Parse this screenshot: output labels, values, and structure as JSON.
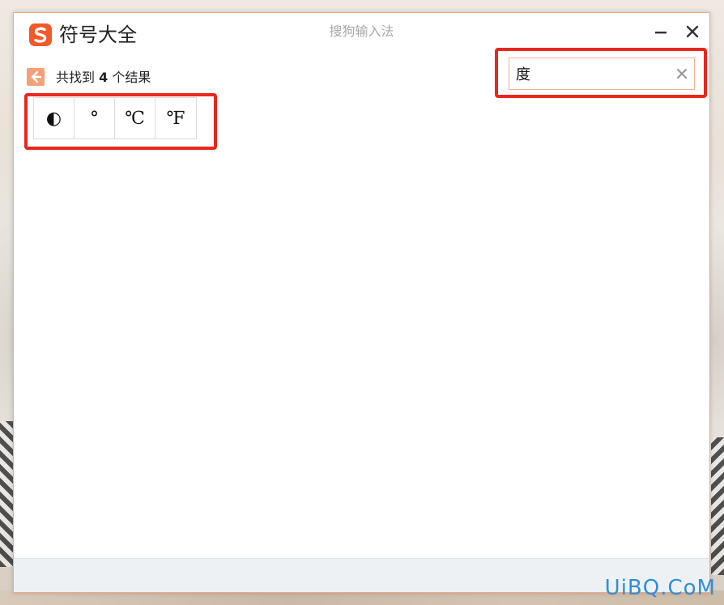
{
  "window": {
    "app_title": "符号大全",
    "center_title": "搜狗输入法"
  },
  "results": {
    "prefix": "共找到 ",
    "count": "4",
    "suffix": " 个结果"
  },
  "search": {
    "value": "度"
  },
  "symbols": [
    "◐",
    "°",
    "℃",
    "℉"
  ],
  "icons": {
    "logo": "sogou-s-logo-icon",
    "minimize": "minimize-icon",
    "close": "close-icon",
    "back": "back-arrow-icon",
    "clear": "clear-x-icon"
  },
  "colors": {
    "accent": "#f4a079",
    "logo": "#f05a28",
    "highlight": "#e8281d",
    "watermark": "#2f8fd8"
  },
  "watermark": "UiBQ.CoM"
}
